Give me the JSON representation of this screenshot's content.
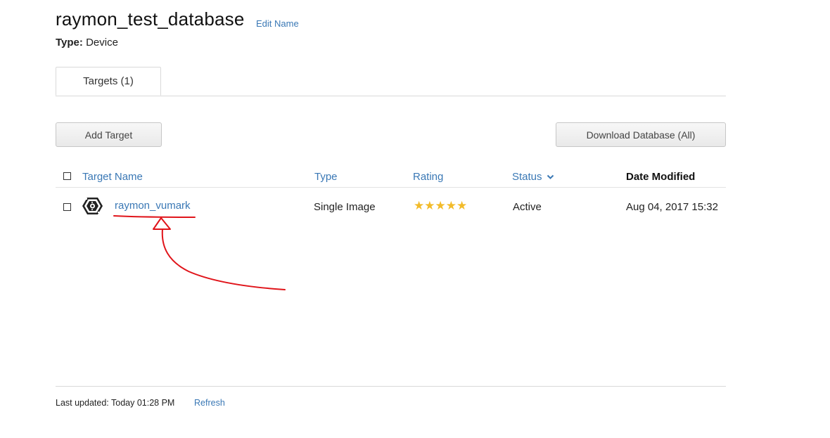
{
  "database": {
    "title": "raymon_test_database",
    "edit_label": "Edit Name",
    "type_label": "Type:",
    "type_value": "Device"
  },
  "tabs": [
    {
      "label": "Targets (1)"
    }
  ],
  "toolbar": {
    "add_label": "Add Target",
    "download_label": "Download Database (All)"
  },
  "table": {
    "columns": {
      "name": "Target Name",
      "type": "Type",
      "rating": "Rating",
      "status": "Status",
      "date": "Date Modified"
    },
    "rows": [
      {
        "name": "raymon_vumark",
        "type": "Single Image",
        "rating": 5,
        "rating_stars": "★★★★★",
        "status": "Active",
        "date": "Aug 04, 2017 15:32",
        "icon": "vumark-icon"
      }
    ]
  },
  "footer": {
    "last_updated": "Last updated: Today 01:28 PM",
    "refresh_label": "Refresh"
  },
  "colors": {
    "link": "#3a78b5",
    "star": "#f2bb2a",
    "annotation": "#e0141a"
  }
}
